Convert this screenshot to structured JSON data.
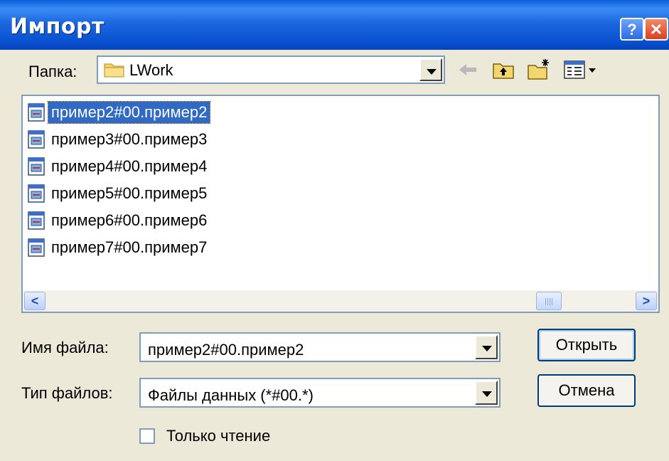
{
  "window": {
    "title": "Импорт"
  },
  "titlebar": {
    "help_label": "?",
    "close_label": "✕"
  },
  "lookin": {
    "label": "Папка:",
    "value": "LWork"
  },
  "toolbar": {
    "icons": [
      "back-arrow-icon",
      "up-folder-icon",
      "new-folder-icon",
      "view-menu-icon"
    ]
  },
  "files": [
    {
      "name": "пример2#00.пример2",
      "selected": true
    },
    {
      "name": "пример3#00.пример3",
      "selected": false
    },
    {
      "name": "пример4#00.пример4",
      "selected": false
    },
    {
      "name": "пример5#00.пример5",
      "selected": false
    },
    {
      "name": "пример6#00.пример6",
      "selected": false
    },
    {
      "name": "пример7#00.пример7",
      "selected": false
    }
  ],
  "filename": {
    "label": "Имя файла:",
    "value": "пример2#00.пример2"
  },
  "filetype": {
    "label": "Тип файлов:",
    "value": "Файлы данных (*#00.*)"
  },
  "buttons": {
    "open": "Открыть",
    "cancel": "Отмена"
  },
  "readonly": {
    "label": "Только чтение",
    "checked": false
  },
  "colors": {
    "titlebar": "#0a5fd8",
    "selection": "#316ac5",
    "dialog_bg": "#ece9d8"
  }
}
